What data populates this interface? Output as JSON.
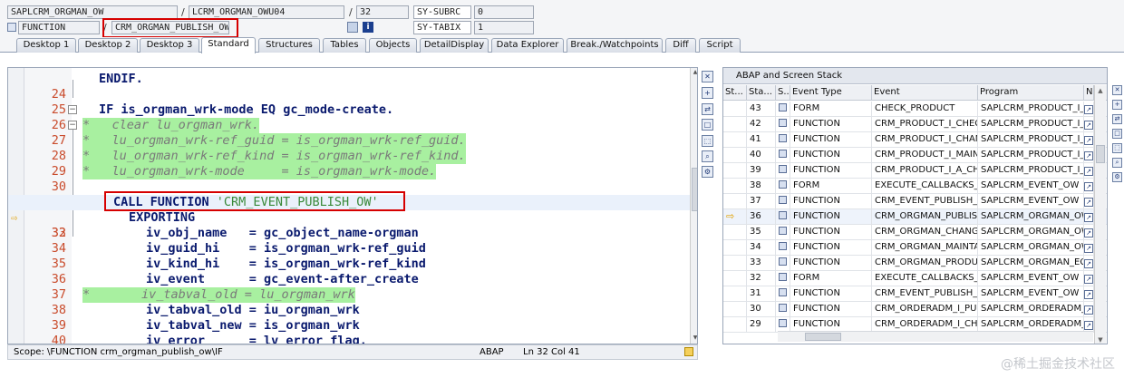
{
  "header": {
    "row1": {
      "program": "SAPLCRM_ORGMAN_OW",
      "include": "LCRM_ORGMAN_OWU04",
      "line": "32",
      "sysvar": "SY-SUBRC",
      "sysval": "0"
    },
    "row2": {
      "type": "FUNCTION",
      "name": "CRM_ORGMAN_PUBLISH_OW",
      "sysvar": "SY-TABIX",
      "sysval": "1"
    },
    "sep": "/"
  },
  "tabs": [
    {
      "label": "Desktop 1",
      "active": false
    },
    {
      "label": "Desktop 2",
      "active": false
    },
    {
      "label": "Desktop 3",
      "active": false
    },
    {
      "label": "Standard",
      "active": true
    },
    {
      "label": "Structures",
      "active": false
    },
    {
      "label": "Tables",
      "active": false
    },
    {
      "label": "Objects",
      "active": false
    },
    {
      "label": "DetailDisplay",
      "active": false
    },
    {
      "label": "Data Explorer",
      "active": false
    },
    {
      "label": "Break./Watchpoints",
      "active": false
    },
    {
      "label": "Diff",
      "active": false
    },
    {
      "label": "Script",
      "active": false
    }
  ],
  "editor": {
    "lines": [
      {
        "num": "24",
        "text": "ENDIF.",
        "kind": "code",
        "indent": 0
      },
      {
        "num": "25",
        "text": "",
        "kind": "code",
        "indent": 0
      },
      {
        "num": "26",
        "text": "IF is_orgman_wrk-mode EQ gc_mode-create.",
        "kind": "code",
        "indent": 0
      },
      {
        "num": "27",
        "text": "*   clear lu_orgman_wrk.",
        "kind": "comment"
      },
      {
        "num": "28",
        "text": "*   lu_orgman_wrk-ref_guid = is_orgman_wrk-ref_guid.",
        "kind": "comment"
      },
      {
        "num": "29",
        "text": "*   lu_orgman_wrk-ref_kind = is_orgman_wrk-ref_kind.",
        "kind": "comment"
      },
      {
        "num": "30",
        "text": "*   lu_orgman_wrk-mode     = is_orgman_wrk-mode.",
        "kind": "comment"
      },
      {
        "num": "31",
        "text": "",
        "kind": "code"
      },
      {
        "num": "32",
        "text_kw": "CALL FUNCTION ",
        "text_str": "'CRM_EVENT_PUBLISH_OW'",
        "kind": "call"
      },
      {
        "num": "33",
        "text": "EXPORTING",
        "kind": "code"
      },
      {
        "num": "34",
        "text": "iv_obj_name   = gc_object_name-orgman",
        "kind": "code"
      },
      {
        "num": "35",
        "text": "iv_guid_hi    = is_orgman_wrk-ref_guid",
        "kind": "code"
      },
      {
        "num": "36",
        "text": "iv_kind_hi    = is_orgman_wrk-ref_kind",
        "kind": "code"
      },
      {
        "num": "37",
        "text": "iv_event      = gc_event-after_create",
        "kind": "code"
      },
      {
        "num": "38",
        "text": "*       iv_tabval_old = lu_orgman_wrk",
        "kind": "comment"
      },
      {
        "num": "39",
        "text": "iv_tabval_old = iu_orgman_wrk",
        "kind": "code"
      },
      {
        "num": "40",
        "text": "iv_tabval_new = is_orgman_wrk",
        "kind": "code"
      },
      {
        "num": "41",
        "text": "iv_error      = lv_error_flag.",
        "kind": "code"
      }
    ],
    "current_line": "32"
  },
  "status": {
    "scope": "Scope: \\FUNCTION crm_orgman_publish_ow\\IF",
    "lang": "ABAP",
    "pos": "Ln  32 Col  41"
  },
  "stack": {
    "title": "ABAP and Screen Stack",
    "columns": [
      "St...",
      "Sta...",
      "S...",
      "Event Type",
      "Event",
      "Program",
      "N"
    ],
    "rows": [
      {
        "sta": "43",
        "type": "FORM",
        "event": "CHECK_PRODUCT",
        "program": "SAPLCRM_PRODUCT_I_..."
      },
      {
        "sta": "42",
        "type": "FUNCTION",
        "event": "CRM_PRODUCT_I_CHECK...",
        "program": "SAPLCRM_PRODUCT_I_..."
      },
      {
        "sta": "41",
        "type": "FUNCTION",
        "event": "CRM_PRODUCT_I_CHAN...",
        "program": "SAPLCRM_PRODUCT_I_..."
      },
      {
        "sta": "40",
        "type": "FUNCTION",
        "event": "CRM_PRODUCT_I_MAIN...",
        "program": "SAPLCRM_PRODUCT_I_..."
      },
      {
        "sta": "39",
        "type": "FUNCTION",
        "event": "CRM_PRODUCT_I_A_CH...",
        "program": "SAPLCRM_PRODUCT_I_EC"
      },
      {
        "sta": "38",
        "type": "FORM",
        "event": "EXECUTE_CALLBACKS_A...",
        "program": "SAPLCRM_EVENT_OW"
      },
      {
        "sta": "37",
        "type": "FUNCTION",
        "event": "CRM_EVENT_PUBLISH_O...",
        "program": "SAPLCRM_EVENT_OW"
      },
      {
        "sta": "36",
        "type": "FUNCTION",
        "event": "CRM_ORGMAN_PUBLISH...",
        "program": "SAPLCRM_ORGMAN_OW",
        "current": true
      },
      {
        "sta": "35",
        "type": "FUNCTION",
        "event": "CRM_ORGMAN_CHANGE...",
        "program": "SAPLCRM_ORGMAN_OW"
      },
      {
        "sta": "34",
        "type": "FUNCTION",
        "event": "CRM_ORGMAN_MAINTAI...",
        "program": "SAPLCRM_ORGMAN_OW"
      },
      {
        "sta": "33",
        "type": "FUNCTION",
        "event": "CRM_ORGMAN_PRODUC...",
        "program": "SAPLCRM_ORGMAN_EC"
      },
      {
        "sta": "32",
        "type": "FORM",
        "event": "EXECUTE_CALLBACKS_A...",
        "program": "SAPLCRM_EVENT_OW"
      },
      {
        "sta": "31",
        "type": "FUNCTION",
        "event": "CRM_EVENT_PUBLISH_O...",
        "program": "SAPLCRM_EVENT_OW"
      },
      {
        "sta": "30",
        "type": "FUNCTION",
        "event": "CRM_ORDERADM_I_PUB...",
        "program": "SAPLCRM_ORDERADM_I..."
      },
      {
        "sta": "29",
        "type": "FUNCTION",
        "event": "CRM_ORDERADM_I_CHA...",
        "program": "SAPLCRM_ORDERADM_I..."
      }
    ]
  },
  "watermark": "@稀土掘金技术社区"
}
